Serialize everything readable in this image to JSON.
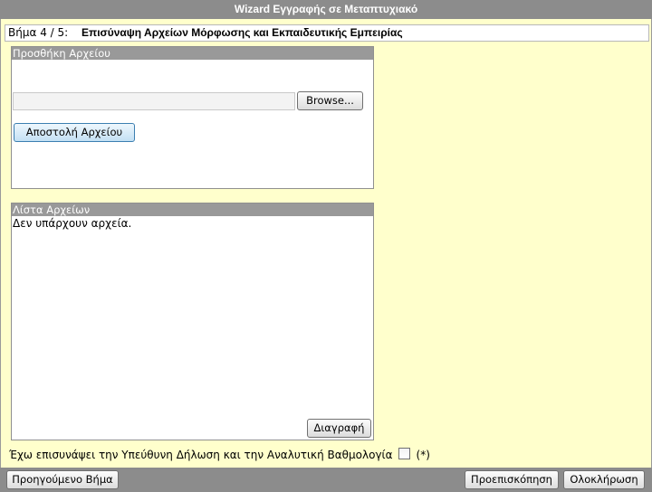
{
  "window": {
    "title": "Wizard Εγγραφής σε Μεταπτυχιακό"
  },
  "step": {
    "number": "Βήμα 4 / 5:",
    "title": "Επισύναψη Αρχείων Μόρφωσης και Εκπαιδευτικής Εμπειρίας"
  },
  "upload": {
    "header": "Προσθήκη Αρχείου",
    "file_value": "",
    "browse_label": "Browse...",
    "upload_label": "Αποστολή Αρχείου"
  },
  "files": {
    "header": "Λίστα Αρχείων",
    "empty_text": "Δεν υπάρχουν αρχεία.",
    "delete_label": "Διαγραφή"
  },
  "confirm": {
    "label": "Έχω επισυνάψει την Υπεύθυνη Δήλωση και την Αναλυτική Βαθμολογία",
    "checked": false,
    "required_mark": "(*)"
  },
  "footer": {
    "prev_label": "Προηγούμενο Βήμα",
    "preview_label": "Προεπισκόπηση",
    "finish_label": "Ολοκλήρωση"
  }
}
